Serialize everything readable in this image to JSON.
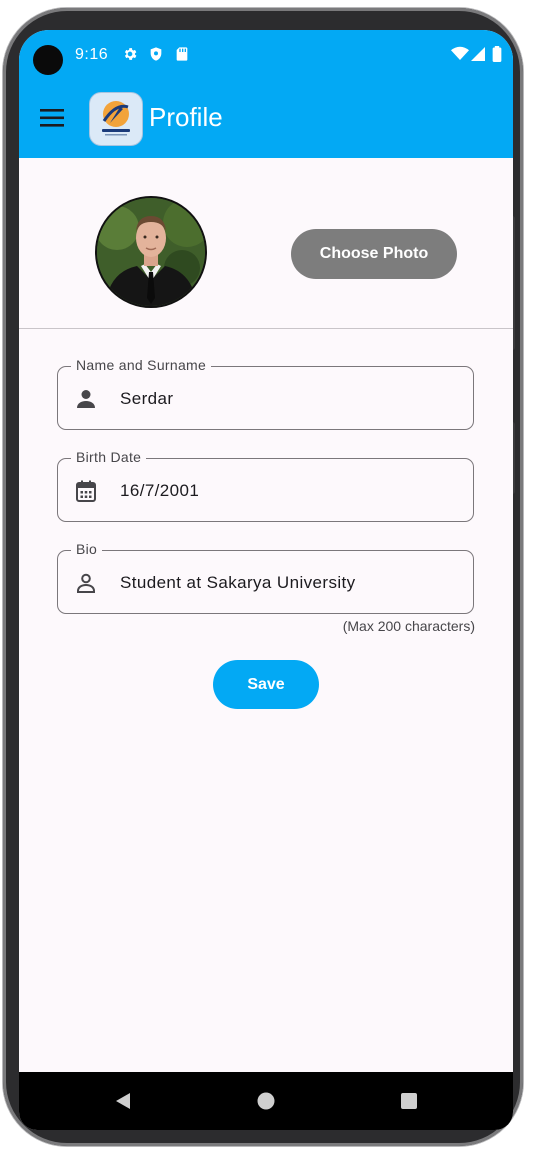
{
  "status_bar": {
    "time": "9:16",
    "icons": [
      "gear-icon",
      "shield-icon",
      "sd-card-icon",
      "wifi-icon",
      "signal-icon",
      "battery-icon"
    ]
  },
  "app_bar": {
    "title": "Profile",
    "menu_icon": "hamburger-menu-icon",
    "logo_alt": "TRAVEL GUIDE"
  },
  "profile": {
    "choose_photo_label": "Choose Photo"
  },
  "form": {
    "name": {
      "label": "Name and Surname",
      "value": "Serdar",
      "icon": "person-icon"
    },
    "birth": {
      "label": "Birth Date",
      "value": "16/7/2001",
      "icon": "calendar-icon"
    },
    "bio": {
      "label": "Bio",
      "value": "Student at Sakarya University",
      "icon": "person-outline-icon",
      "helper": "(Max 200 characters)"
    }
  },
  "save_label": "Save",
  "nav": [
    "back-icon",
    "home-icon",
    "recents-icon"
  ],
  "colors": {
    "primary": "#03a9f4",
    "choose_button": "#7d7d7d",
    "background": "#fdf9fc"
  }
}
